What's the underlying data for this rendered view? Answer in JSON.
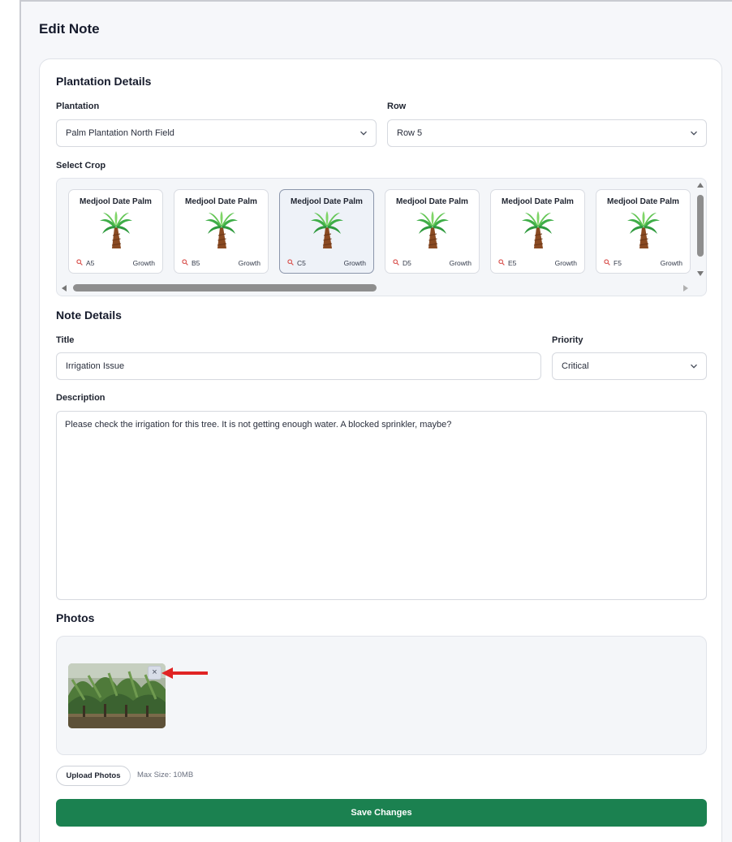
{
  "page": {
    "title": "Edit Note"
  },
  "plantation_details": {
    "heading": "Plantation Details",
    "plantation_label": "Plantation",
    "plantation_value": "Palm Plantation North Field",
    "row_label": "Row",
    "row_value": "Row 5",
    "select_crop_label": "Select Crop",
    "crops": [
      {
        "name": "Medjool Date Palm",
        "id": "A5",
        "stage": "Growth",
        "selected": false
      },
      {
        "name": "Medjool Date Palm",
        "id": "B5",
        "stage": "Growth",
        "selected": false
      },
      {
        "name": "Medjool Date Palm",
        "id": "C5",
        "stage": "Growth",
        "selected": true
      },
      {
        "name": "Medjool Date Palm",
        "id": "D5",
        "stage": "Growth",
        "selected": false
      },
      {
        "name": "Medjool Date Palm",
        "id": "E5",
        "stage": "Growth",
        "selected": false
      },
      {
        "name": "Medjool Date Palm",
        "id": "F5",
        "stage": "Growth",
        "selected": false
      }
    ]
  },
  "note_details": {
    "heading": "Note Details",
    "title_label": "Title",
    "title_value": "Irrigation Issue",
    "priority_label": "Priority",
    "priority_value": "Critical",
    "description_label": "Description",
    "description_value": "Please check the irrigation for this tree. It is not getting enough water. A blocked sprinkler, maybe?"
  },
  "photos": {
    "heading": "Photos",
    "remove_glyph": "×",
    "upload_label": "Upload Photos",
    "max_size_hint": "Max Size: 10MB"
  },
  "actions": {
    "save_label": "Save Changes"
  },
  "colors": {
    "primary_green": "#1b8150",
    "selected_card_bg": "#eef2f8",
    "annotation_arrow": "#e02424"
  },
  "icons": {
    "dropdown": "chevron-down-icon",
    "crop_image": "palm-tree-icon",
    "crop_id": "search-icon",
    "remove_photo": "close-icon"
  }
}
